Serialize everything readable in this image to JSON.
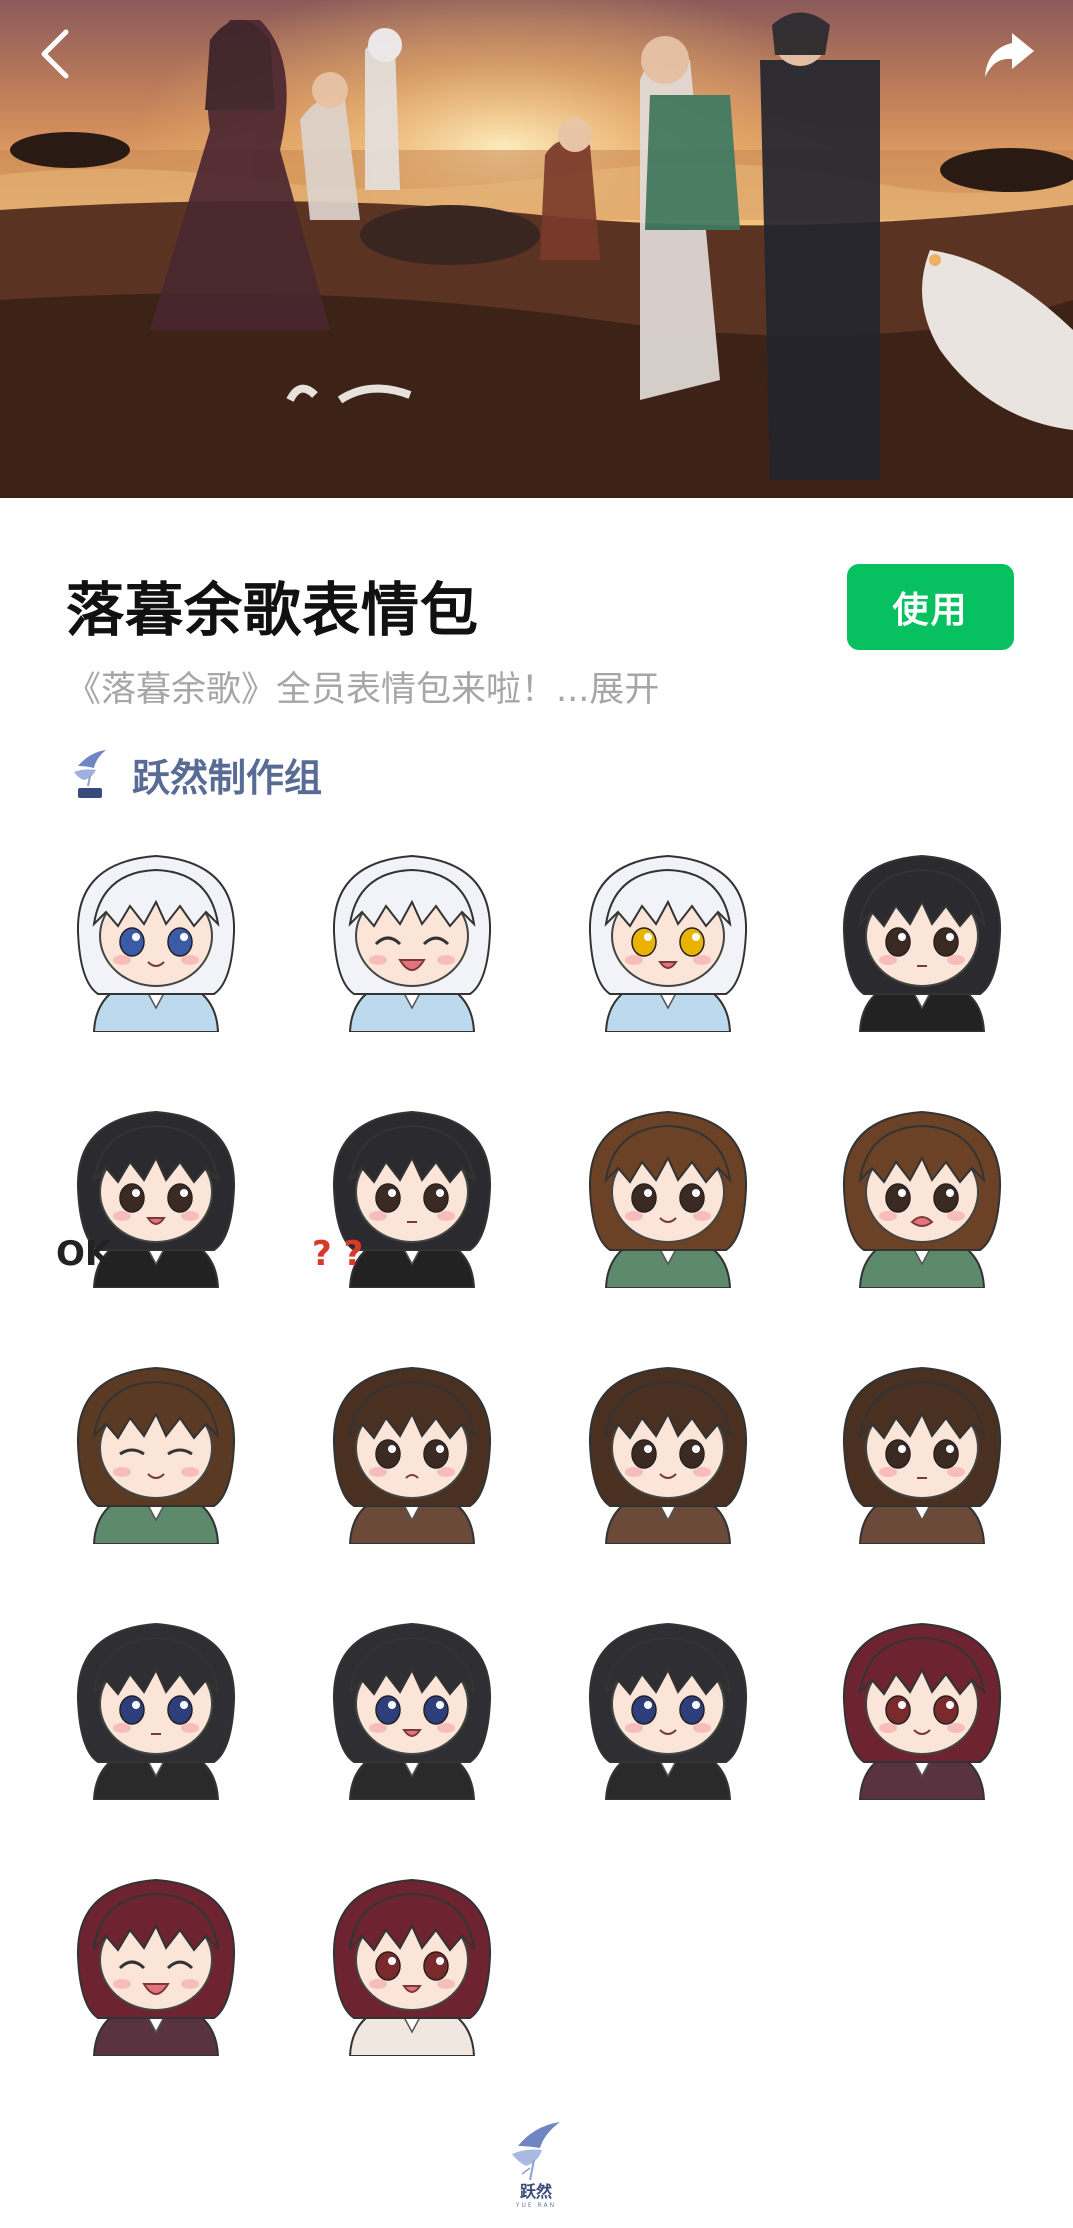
{
  "banner": {
    "back_icon": "chevron-left-icon",
    "share_icon": "share-arrow-icon"
  },
  "pack": {
    "title": "落暮余歌表情包",
    "use_label": "使用",
    "description": "《落暮余歌》全员表情包来啦！",
    "expand_label": "...展开",
    "author": "跃然制作组",
    "accent_color": "#07c160",
    "author_color": "#576b95"
  },
  "stickers": [
    {
      "hair": "#f2f3f8",
      "eyes": "#3b5aa8",
      "outfit": "#bcd9ee",
      "mouth": "smile"
    },
    {
      "hair": "#f2f3f8",
      "eyes": "#3b3b3b",
      "outfit": "#bcd9ee",
      "mouth": "laugh"
    },
    {
      "hair": "#f2f3f8",
      "eyes": "#e9b300",
      "outfit": "#bcd9ee",
      "mouth": "open"
    },
    {
      "hair": "#2b2b2f",
      "eyes": "#3a2a22",
      "outfit": "#222222",
      "mouth": "neutral"
    },
    {
      "hair": "#2b2b2f",
      "eyes": "#3a2a22",
      "outfit": "#222222",
      "mouth": "open",
      "label": "OK"
    },
    {
      "hair": "#2b2b2f",
      "eyes": "#3a2a22",
      "outfit": "#222222",
      "mouth": "neutral",
      "label": "? ?"
    },
    {
      "hair": "#6b4226",
      "eyes": "#3a2a22",
      "outfit": "#5c8a6a",
      "mouth": "smile"
    },
    {
      "hair": "#6b4226",
      "eyes": "#3a2a22",
      "outfit": "#5c8a6a",
      "mouth": "cry"
    },
    {
      "hair": "#5a3a22",
      "eyes": "#3a2a22",
      "outfit": "#5c8a6a",
      "mouth": "closed"
    },
    {
      "hair": "#4a3020",
      "eyes": "#3a2a22",
      "outfit": "#6b4a3a",
      "mouth": "pout"
    },
    {
      "hair": "#4a3020",
      "eyes": "#3a2a22",
      "outfit": "#6b4a3a",
      "mouth": "smile"
    },
    {
      "hair": "#4a3020",
      "eyes": "#3a2a22",
      "outfit": "#6b4a3a",
      "mouth": "neutral"
    },
    {
      "hair": "#2e2e33",
      "eyes": "#2c3f7a",
      "outfit": "#2a2a2a",
      "mouth": "neutral"
    },
    {
      "hair": "#2e2e33",
      "eyes": "#2c3f7a",
      "outfit": "#2a2a2a",
      "mouth": "open"
    },
    {
      "hair": "#2e2e33",
      "eyes": "#2c3f7a",
      "outfit": "#2a2a2a",
      "mouth": "smile"
    },
    {
      "hair": "#6e2430",
      "eyes": "#7a2a2a",
      "outfit": "#5a3340",
      "mouth": "smile"
    },
    {
      "hair": "#6e2430",
      "eyes": "#7a2a2a",
      "outfit": "#5a3340",
      "mouth": "laugh"
    },
    {
      "hair": "#6e2430",
      "eyes": "#7a2a2a",
      "outfit": "#efe7e0",
      "mouth": "open"
    }
  ],
  "footer": {
    "brand": "跃然",
    "brand_sub": "YUE RAN"
  }
}
